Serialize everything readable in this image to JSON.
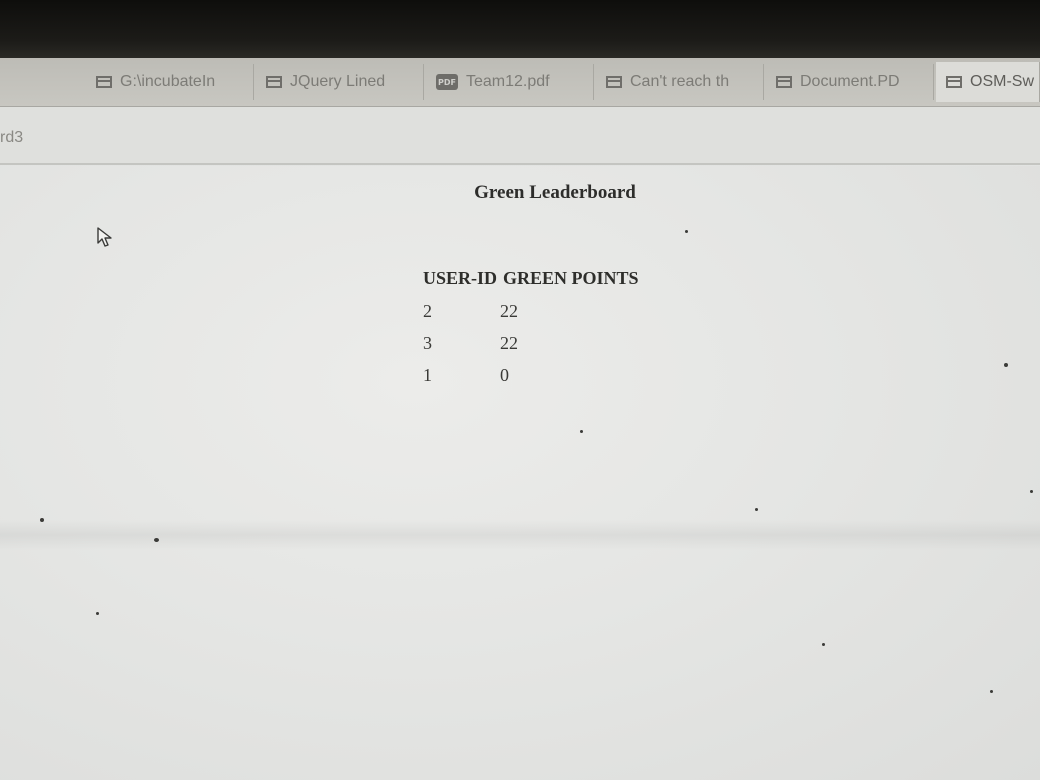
{
  "browser": {
    "tabs": [
      {
        "label": "G:\\incubateIn",
        "icon": "page-icon",
        "active": false
      },
      {
        "label": "JQuery Lined",
        "icon": "page-icon",
        "active": false
      },
      {
        "label": "Team12.pdf",
        "icon": "pdf-icon",
        "active": false
      },
      {
        "label": "Can't reach th",
        "icon": "page-icon",
        "active": false
      },
      {
        "label": "Document.PD",
        "icon": "page-icon",
        "active": false
      },
      {
        "label": "OSM-Sw",
        "icon": "page-icon",
        "active": true
      }
    ],
    "address_text": "rd3"
  },
  "page": {
    "title": "Green Leaderboard",
    "table": {
      "headers": [
        "USER-ID",
        "GREEN POINTS"
      ],
      "rows": [
        {
          "user_id": "2",
          "points": "22"
        },
        {
          "user_id": "3",
          "points": "22"
        },
        {
          "user_id": "1",
          "points": "0"
        }
      ]
    }
  }
}
